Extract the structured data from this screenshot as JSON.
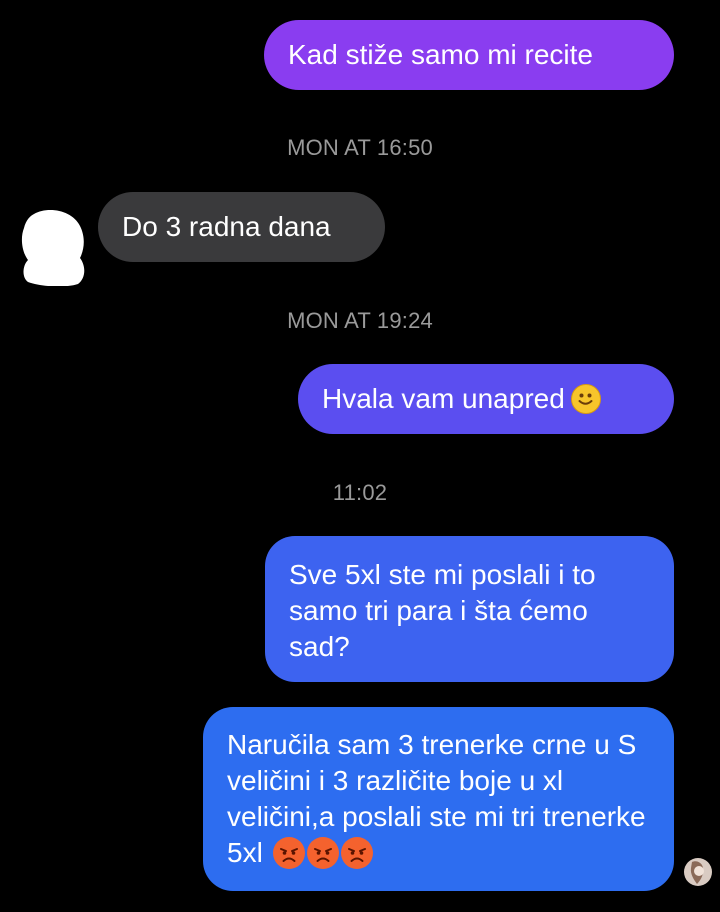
{
  "messages": [
    {
      "id": "m1",
      "side": "outgoing",
      "text": "Kad stiže samo mi recite"
    },
    {
      "id": "m2",
      "side": "incoming",
      "text": "Do 3 radna dana"
    },
    {
      "id": "m3",
      "side": "outgoing",
      "text": "Hvala vam unapred",
      "emoji": "slightly-smiling-face-icon"
    },
    {
      "id": "m4",
      "side": "outgoing",
      "text": "Sve 5xl ste mi poslali i to samo tri para i šta ćemo sad?"
    },
    {
      "id": "m5",
      "side": "outgoing",
      "text": "Naručila sam 3 trenerke crne u S veličini i 3 različite boje u xl veličini,a poslali ste mi tri trenerke 5xl",
      "emoji": [
        "angry-face-icon",
        "angry-face-icon",
        "angry-face-icon"
      ]
    }
  ],
  "timestamps": {
    "t1": "MON AT 16:50",
    "t2": "MON AT 19:24",
    "t3": "11:02"
  },
  "colors": {
    "background": "#000000",
    "outgoing_top": "#8a3df0",
    "outgoing_mid": "#5b4ef0",
    "outgoing_bottom": "#2d6df0",
    "incoming": "#3a3a3c",
    "timestamp": "#9a9a9a"
  }
}
